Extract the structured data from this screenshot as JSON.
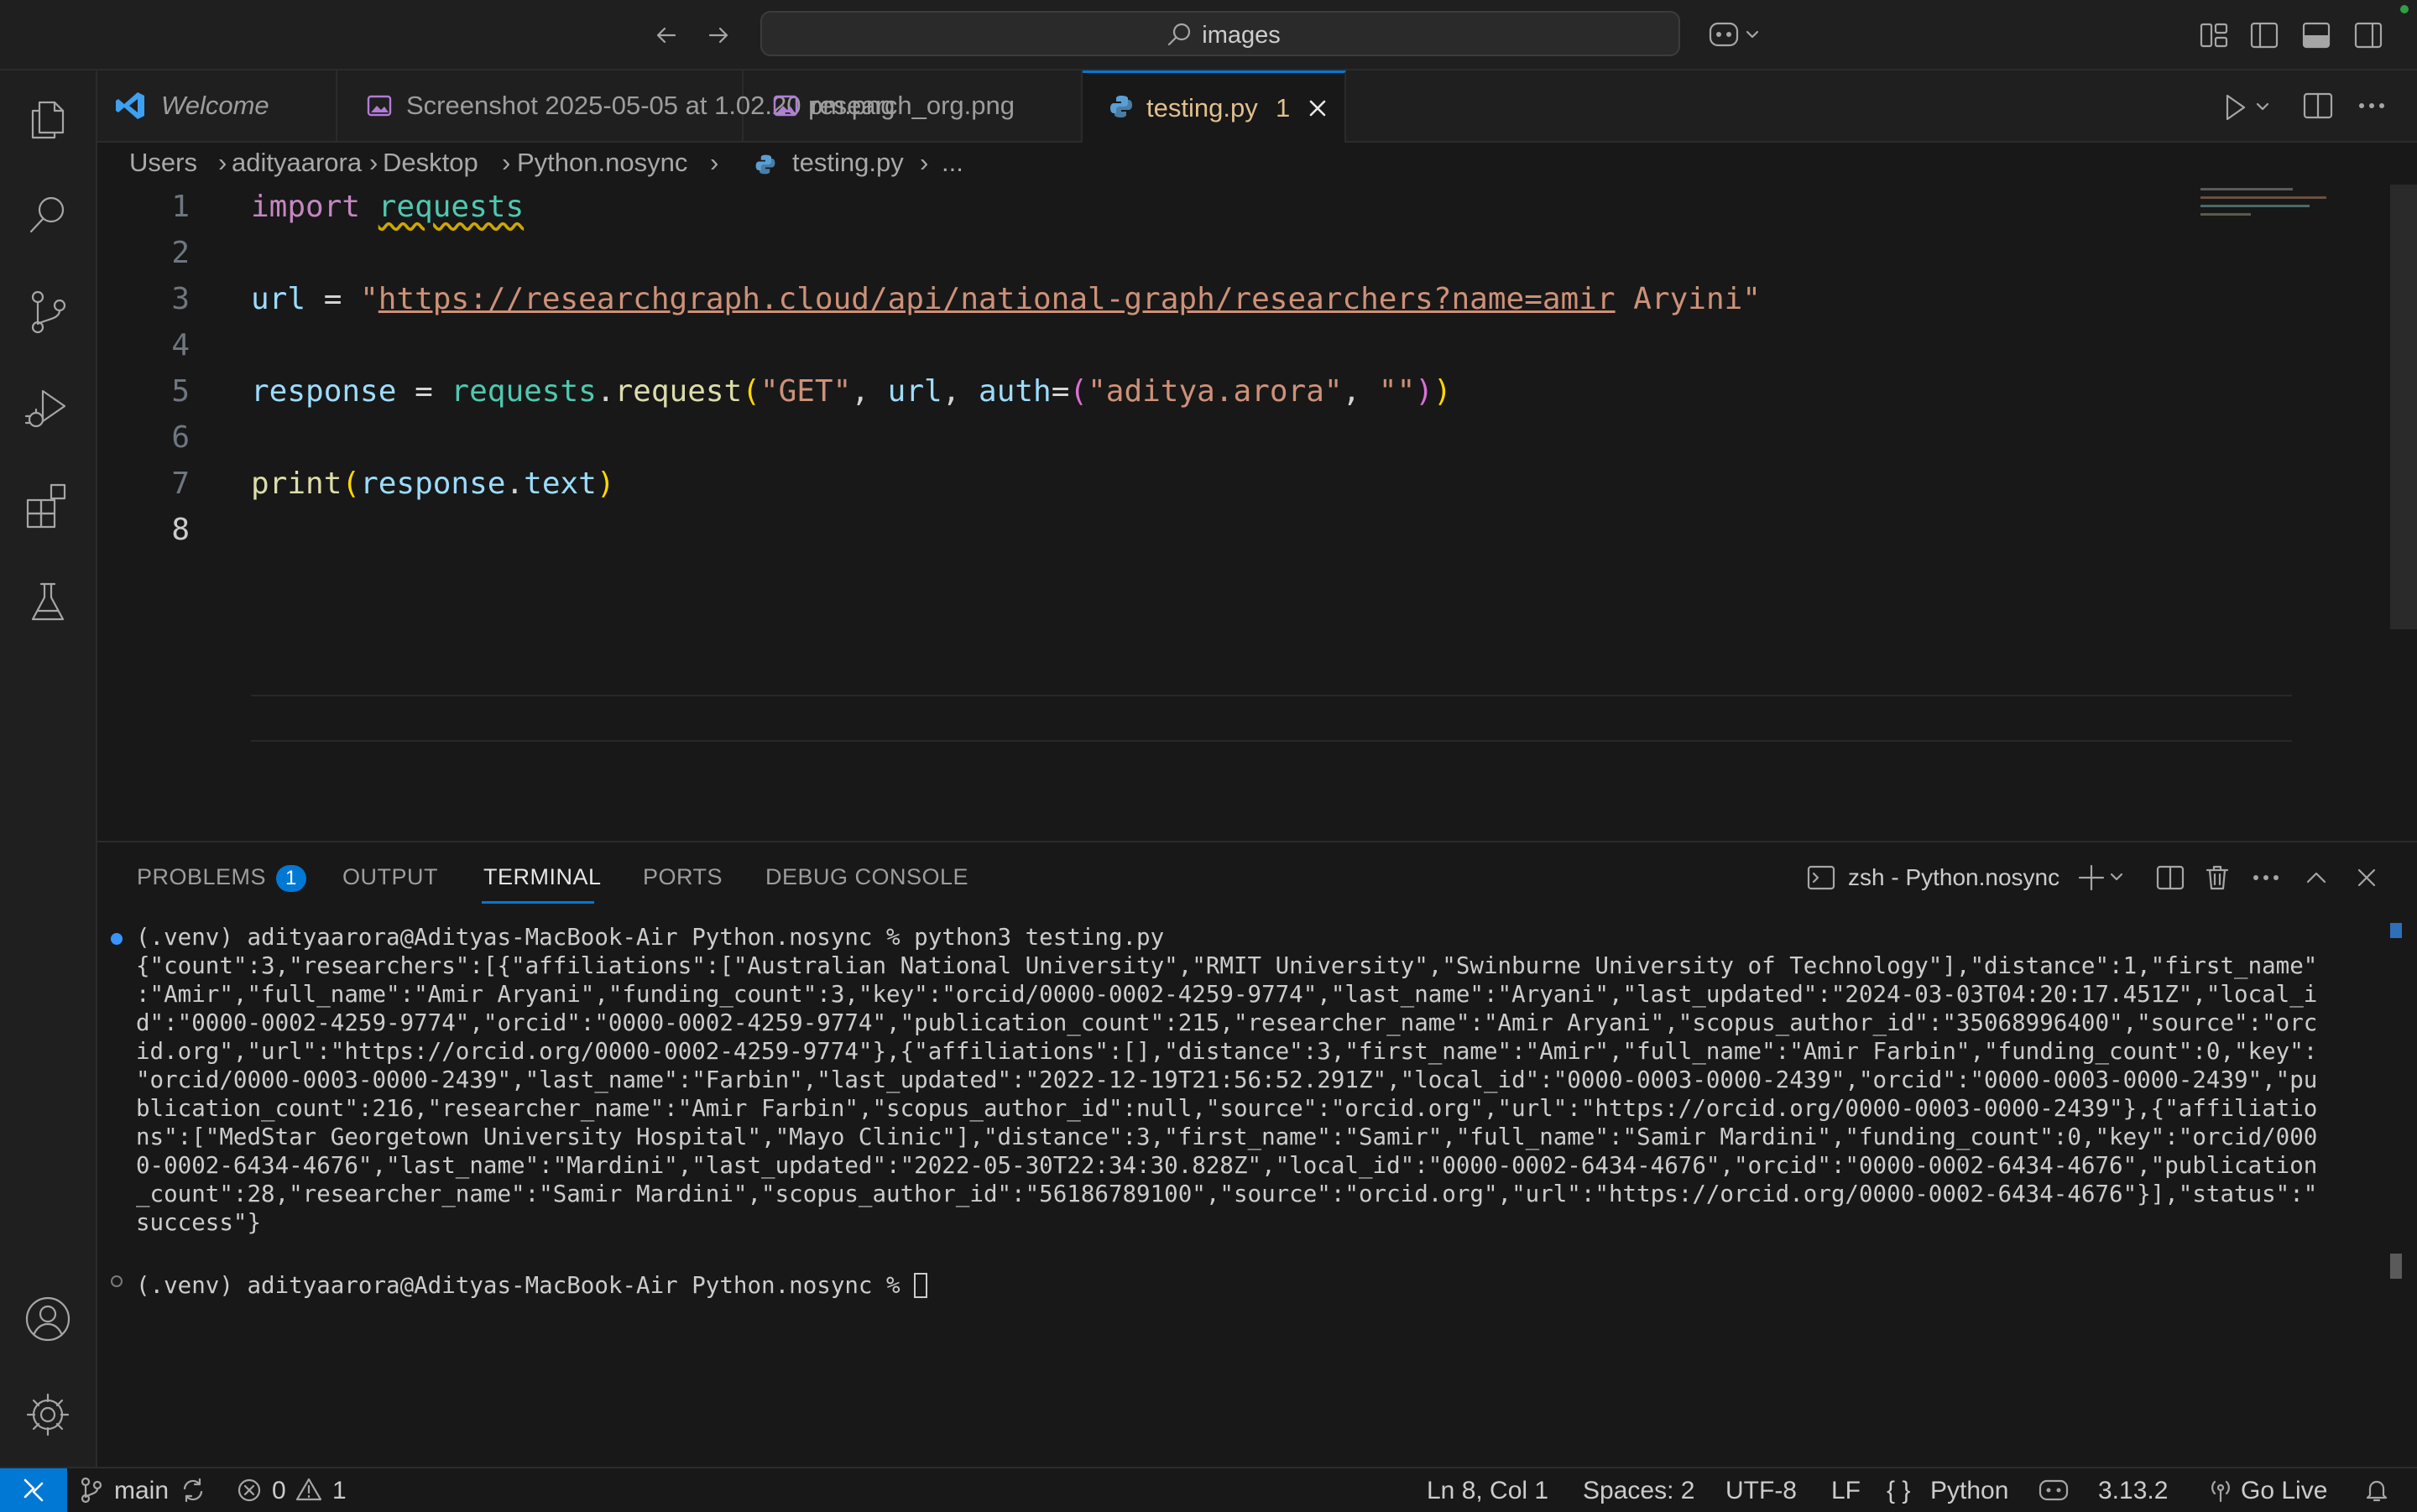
{
  "titlebar": {
    "search_text": "images"
  },
  "tabs": [
    {
      "label": "Welcome"
    },
    {
      "label": "Screenshot 2025-05-05 at 1.02.20 pm.png"
    },
    {
      "label": "research_org.png"
    },
    {
      "label": "testing.py",
      "problems": "1"
    }
  ],
  "breadcrumb": [
    "Users",
    "adityaarora",
    "Desktop",
    "Python.nosync",
    "testing.py",
    "..."
  ],
  "editor": {
    "line_numbers": [
      "1",
      "2",
      "3",
      "4",
      "5",
      "6",
      "7",
      "8"
    ],
    "line1": {
      "kw": "import",
      "mod": "requests"
    },
    "line3": {
      "var": "url",
      "op": " = ",
      "q1": "\"",
      "link": "https://researchgraph.cloud/api/national-graph/researchers?name=amir",
      "rest": " Aryini\""
    },
    "line5": {
      "var": "response",
      "op": " = ",
      "mod": "requests",
      "dot": ".",
      "fn": "request",
      "p": "(",
      "s1": "\"GET\"",
      "c1": ", ",
      "v2": "url",
      "c2": ", ",
      "v3": "auth",
      "eq": "=",
      "p2": "(",
      "s2": "\"aditya.arora\"",
      "c3": ", ",
      "s3": "\"\"",
      "p2c": ")",
      "pc": ")"
    },
    "line7": {
      "fn": "print",
      "p": "(",
      "var": "response",
      "dot": ".",
      "attr": "text",
      "pc": ")"
    }
  },
  "panel": {
    "tabs": {
      "problems": "PROBLEMS",
      "problems_count": "1",
      "output": "OUTPUT",
      "terminal": "TERMINAL",
      "ports": "PORTS",
      "debug": "DEBUG CONSOLE"
    },
    "terminal_name": "zsh - Python.nosync",
    "terminal_lines": [
      "(.venv) adityaarora@Adityas-MacBook-Air Python.nosync % python3 testing.py",
      "{\"count\":3,\"researchers\":[{\"affiliations\":[\"Australian National University\",\"RMIT University\",\"Swinburne University of Technology\"],\"distance\":1,\"first_name\"",
      ":\"Amir\",\"full_name\":\"Amir Aryani\",\"funding_count\":3,\"key\":\"orcid/0000-0002-4259-9774\",\"last_name\":\"Aryani\",\"last_updated\":\"2024-03-03T04:20:17.451Z\",\"local_i",
      "d\":\"0000-0002-4259-9774\",\"orcid\":\"0000-0002-4259-9774\",\"publication_count\":215,\"researcher_name\":\"Amir Aryani\",\"scopus_author_id\":\"35068996400\",\"source\":\"orc",
      "id.org\",\"url\":\"https://orcid.org/0000-0002-4259-9774\"},{\"affiliations\":[],\"distance\":3,\"first_name\":\"Amir\",\"full_name\":\"Amir Farbin\",\"funding_count\":0,\"key\":",
      "\"orcid/0000-0003-0000-2439\",\"last_name\":\"Farbin\",\"last_updated\":\"2022-12-19T21:56:52.291Z\",\"local_id\":\"0000-0003-0000-2439\",\"orcid\":\"0000-0003-0000-2439\",\"pu",
      "blication_count\":216,\"researcher_name\":\"Amir Farbin\",\"scopus_author_id\":null,\"source\":\"orcid.org\",\"url\":\"https://orcid.org/0000-0003-0000-2439\"},{\"affiliatio",
      "ns\":[\"MedStar Georgetown University Hospital\",\"Mayo Clinic\"],\"distance\":3,\"first_name\":\"Samir\",\"full_name\":\"Samir Mardini\",\"funding_count\":0,\"key\":\"orcid/000",
      "0-0002-6434-4676\",\"last_name\":\"Mardini\",\"last_updated\":\"2022-05-30T22:34:30.828Z\",\"local_id\":\"0000-0002-6434-4676\",\"orcid\":\"0000-0002-6434-4676\",\"publication",
      "_count\":28,\"researcher_name\":\"Samir Mardini\",\"scopus_author_id\":\"56186789100\",\"source\":\"orcid.org\",\"url\":\"https://orcid.org/0000-0002-6434-4676\"}],\"status\":\"",
      "success\"}"
    ],
    "prompt": "(.venv) adityaarora@Adityas-MacBook-Air Python.nosync % "
  },
  "statusbar": {
    "branch": "main",
    "errors": "0",
    "warnings": "1",
    "position": "Ln 8, Col 1",
    "spaces": "Spaces: 2",
    "encoding": "UTF-8",
    "eol": "LF",
    "language": "Python",
    "version": "3.13.2",
    "golive": "Go Live"
  },
  "colors": {
    "accent": "#0078d4",
    "modified_tab": "#e2c08d",
    "bg": "#181818"
  }
}
